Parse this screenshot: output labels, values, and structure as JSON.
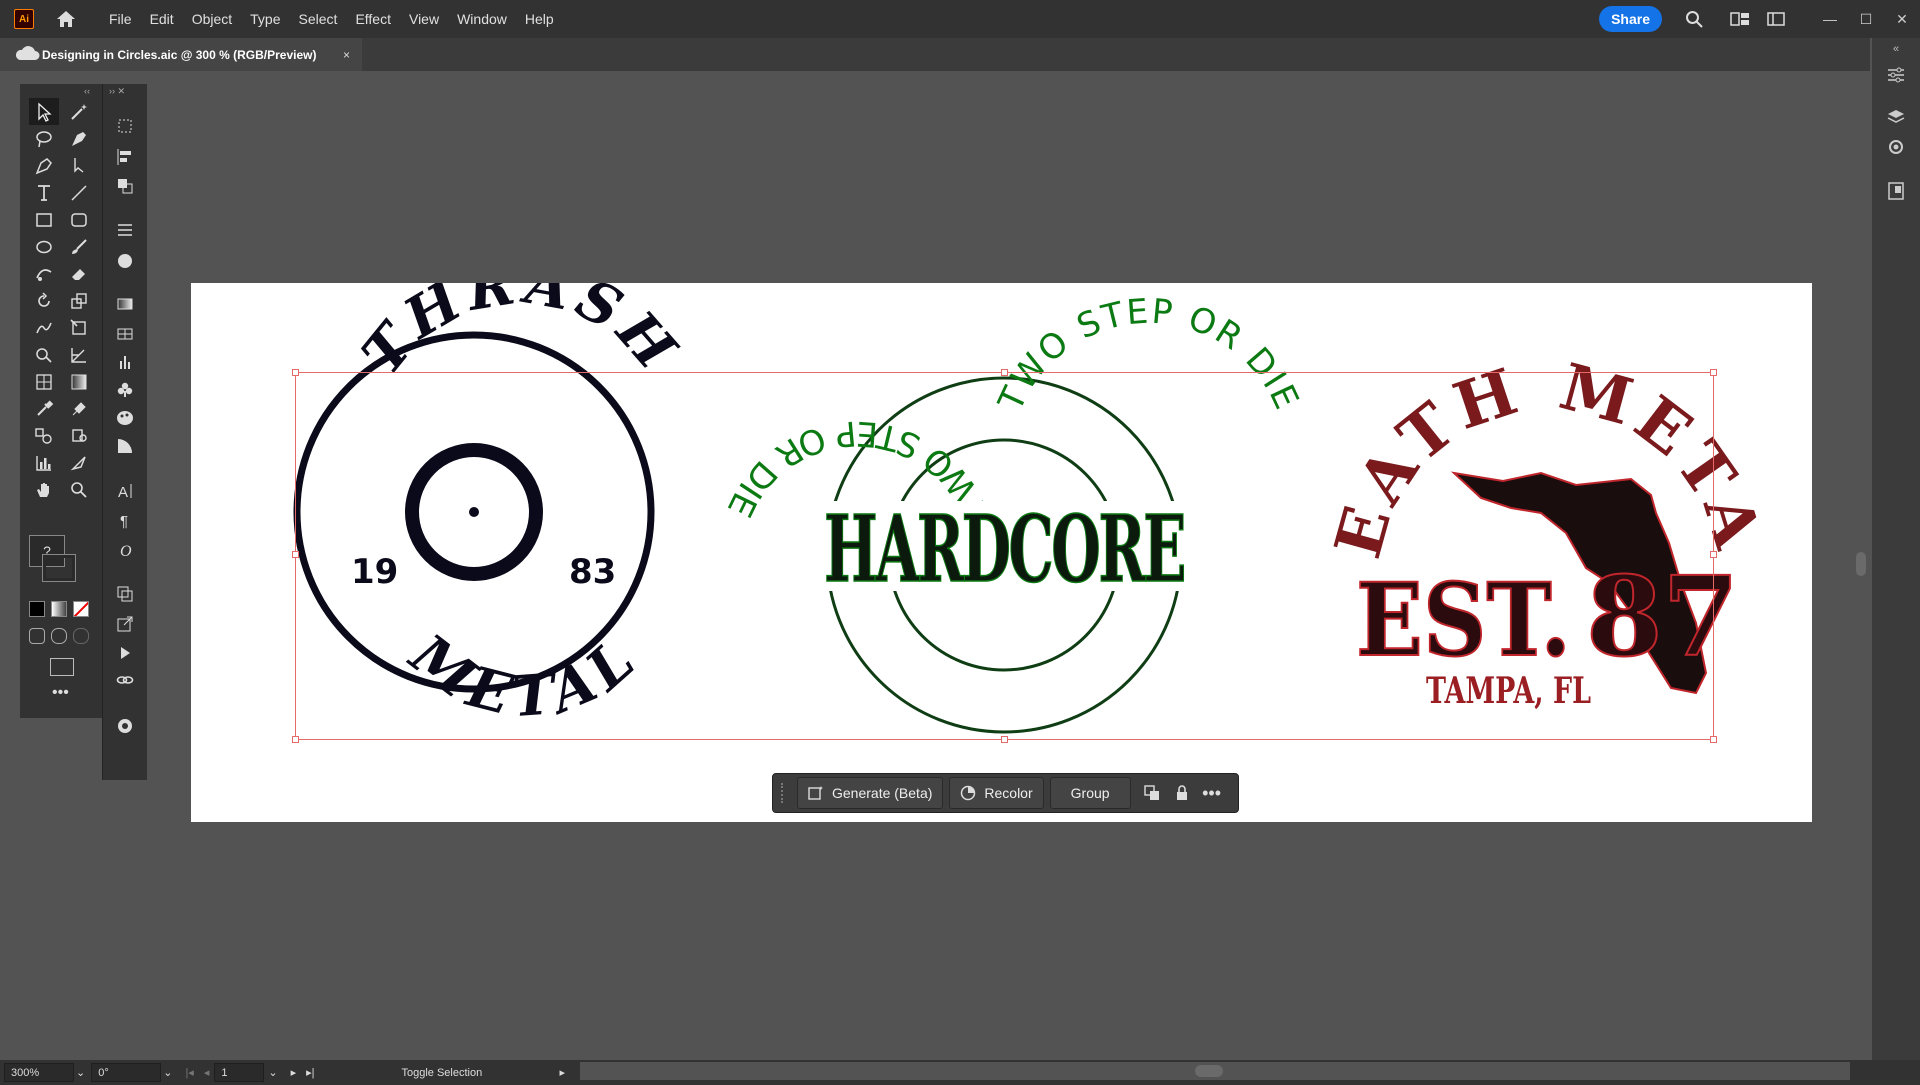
{
  "app": {
    "logo": "Ai"
  },
  "menu": [
    "File",
    "Edit",
    "Object",
    "Type",
    "Select",
    "Effect",
    "View",
    "Window",
    "Help"
  ],
  "toolbar_right": {
    "share_label": "Share"
  },
  "document_tab": {
    "title": "Designing in Circles.aic @ 300 % (RGB/Preview)",
    "close": "×"
  },
  "artwork": {
    "thrash": {
      "top": "THRASH",
      "bottom": "METAL",
      "left_number": "19",
      "right_number": "83"
    },
    "hardcore": {
      "arc_top": "TWO STEP OR DIE",
      "main": "HARDCORE",
      "arc_bottom": "TWO STEP OR DIE"
    },
    "death": {
      "arc": "DEATH METAL",
      "est": "EST.",
      "year": "87",
      "city": "TAMPA, FL"
    }
  },
  "context_bar": {
    "generate": "Generate (Beta)",
    "recolor": "Recolor",
    "group": "Group"
  },
  "status": {
    "zoom": "300%",
    "rotation": "0°",
    "artboard": "1",
    "tool_status": "Toggle Selection"
  },
  "colors": {
    "accent": "#1473e6",
    "selection": "#e56b6b",
    "hardcore_green": "#0c7a13",
    "death_red": "#c0262c"
  }
}
